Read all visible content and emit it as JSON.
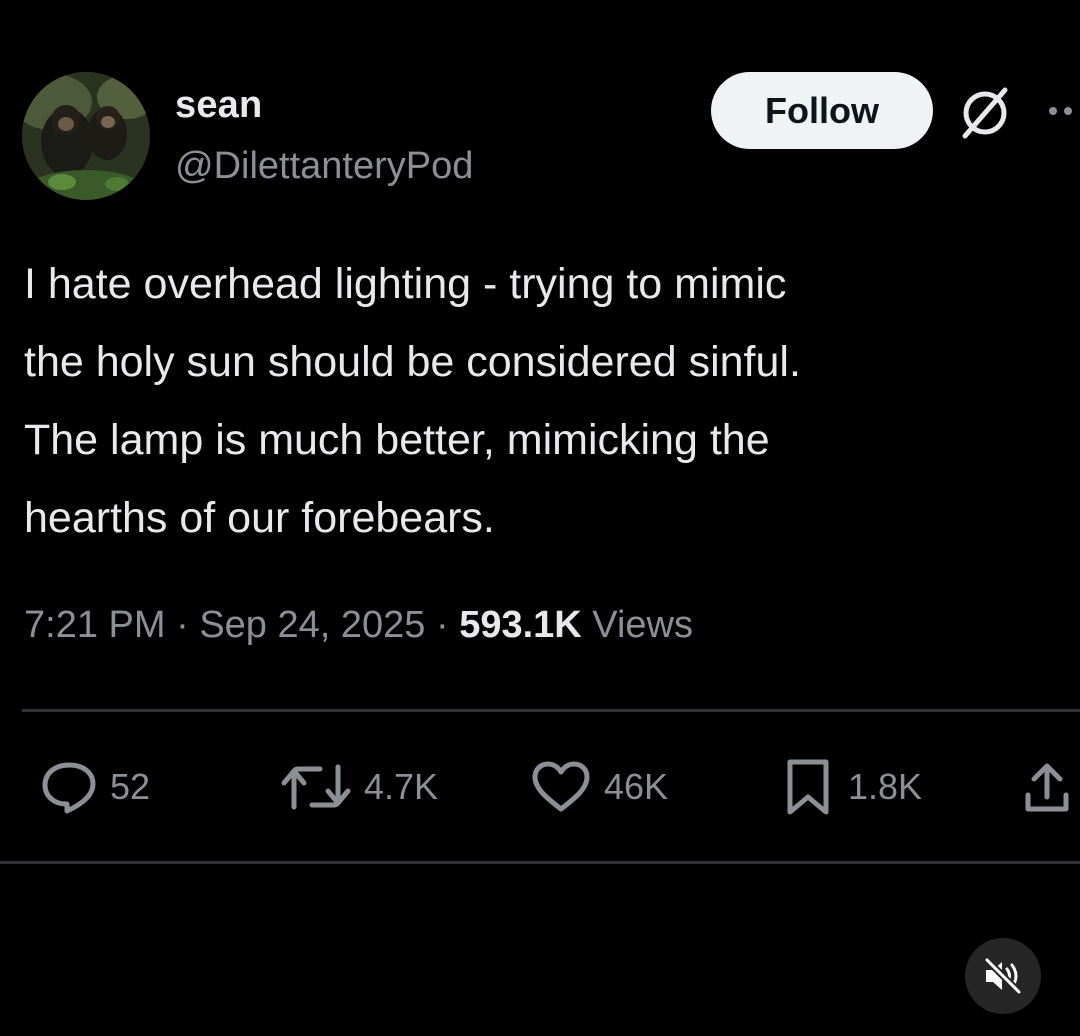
{
  "author": {
    "display_name": "sean",
    "handle": "@DilettanteryPod"
  },
  "header": {
    "follow_label": "Follow",
    "icons": [
      "grok-icon",
      "more-icon"
    ]
  },
  "tweet": {
    "text": "I hate overhead lighting - trying to mimic\nthe holy sun should be considered sinful.\nThe lamp is much better, mimicking the\nhearths of our forebears."
  },
  "meta": {
    "time": "7:21 PM",
    "separator": "·",
    "date": "Sep 24, 2025",
    "views_count": "593.1K",
    "views_label": "Views"
  },
  "actions": {
    "replies": "52",
    "reposts": "4.7K",
    "likes": "46K",
    "bookmarks": "1.8K"
  },
  "colors": {
    "background": "#000000",
    "text_primary": "#e7e9ea",
    "text_secondary": "#8b9096",
    "divider": "#2f3336",
    "follow_bg": "#eff3f4"
  }
}
